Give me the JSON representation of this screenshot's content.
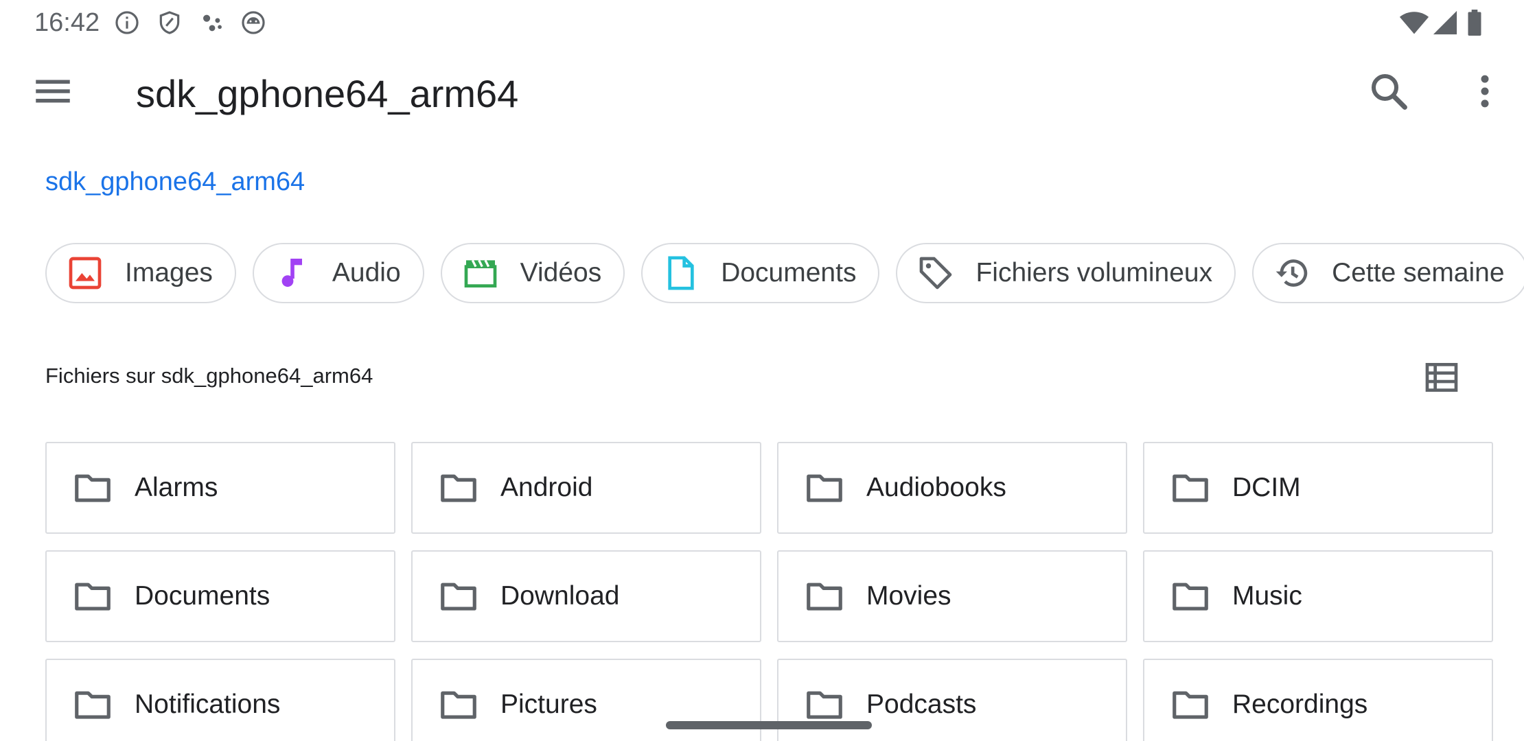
{
  "status_bar": {
    "time": "16:42",
    "icons": [
      "info-icon",
      "shield-icon",
      "assistant-dots-icon",
      "android-head-icon"
    ],
    "right_icons": [
      "wifi-icon",
      "cell-signal-icon",
      "battery-icon"
    ]
  },
  "app_bar": {
    "title": "sdk_gphone64_arm64",
    "icons": [
      "menu-icon",
      "search-icon",
      "more-vert-icon"
    ]
  },
  "breadcrumb": "sdk_gphone64_arm64",
  "chips": [
    {
      "label": "Images",
      "icon": "image-icon",
      "color": "#ea4335"
    },
    {
      "label": "Audio",
      "icon": "music-note-icon",
      "color": "#a142f4"
    },
    {
      "label": "Vidéos",
      "icon": "movie-clapper-icon",
      "color": "#34a853"
    },
    {
      "label": "Documents",
      "icon": "document-icon",
      "color": "#24c1e0"
    },
    {
      "label": "Fichiers volumineux",
      "icon": "tag-icon",
      "color": "#5f6368"
    },
    {
      "label": "Cette semaine",
      "icon": "history-icon",
      "color": "#5f6368"
    }
  ],
  "section": {
    "title": "Fichiers sur sdk_gphone64_arm64",
    "view_icon": "list-view-icon"
  },
  "folders": [
    {
      "label": "Alarms"
    },
    {
      "label": "Android"
    },
    {
      "label": "Audiobooks"
    },
    {
      "label": "DCIM"
    },
    {
      "label": "Documents"
    },
    {
      "label": "Download"
    },
    {
      "label": "Movies"
    },
    {
      "label": "Music"
    },
    {
      "label": "Notifications"
    },
    {
      "label": "Pictures"
    },
    {
      "label": "Podcasts"
    },
    {
      "label": "Recordings"
    }
  ],
  "colors": {
    "accent": "#1a73e8",
    "text_primary": "#202124",
    "icon_gray": "#5f6368",
    "border": "#dadce0"
  }
}
